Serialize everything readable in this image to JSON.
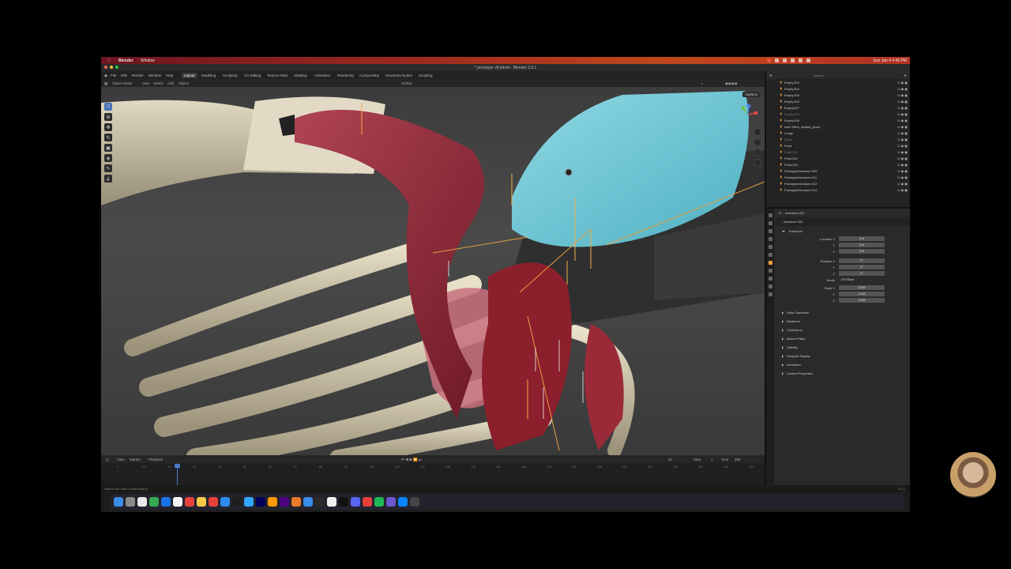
{
  "menubar": {
    "app": "Blender",
    "menu": "Window",
    "clock": "Sun Jan 4  4:46 PM"
  },
  "window": {
    "title": "* prototype v8.blend - Blender 5.0.1"
  },
  "blender_menu": {
    "items": [
      "File",
      "Edit",
      "Render",
      "Window",
      "Help"
    ],
    "workspaces": [
      "Layout",
      "Modeling",
      "Sculpting",
      "UV Editing",
      "Texture Paint",
      "Shading",
      "Animation",
      "Rendering",
      "Compositing",
      "Geometry Nodes",
      "Scripting"
    ],
    "active_workspace": "Layout",
    "scene": "Scene",
    "view_layer": "ViewLayer"
  },
  "viewport": {
    "mode": "Object Mode",
    "menus": [
      "View",
      "Select",
      "Add",
      "Object"
    ],
    "orientation": "Global",
    "perspective_label": "User Perspective",
    "options_label": "Options"
  },
  "timeline": {
    "menus": [
      "View",
      "Marker",
      "Playback"
    ],
    "current_frame": "22",
    "start_label": "Start",
    "start": "1",
    "end_label": "End",
    "end": "250",
    "ticks": [
      "0",
      "10",
      "20",
      "30",
      "40",
      "50",
      "60",
      "70",
      "80",
      "90",
      "100",
      "110",
      "120",
      "130",
      "140",
      "150",
      "160",
      "170",
      "180",
      "190",
      "200",
      "210",
      "220",
      "230",
      "240",
      "250"
    ]
  },
  "outliner": {
    "search_placeholder": "Search",
    "items": [
      {
        "name": "Empty.003",
        "dim": false
      },
      {
        "name": "Empty.004",
        "dim": false
      },
      {
        "name": "Empty.005",
        "dim": false
      },
      {
        "name": "Empty.006",
        "dim": false
      },
      {
        "name": "Empty.007",
        "dim": false
      },
      {
        "name": "Empty.008",
        "dim": true
      },
      {
        "name": "Empty.009",
        "dim": false
      },
      {
        "name": "low2.Sterb_default_group",
        "dim": false
      },
      {
        "name": "Lungs",
        "dim": false
      },
      {
        "name": "Glass",
        "dim": true
      },
      {
        "name": "Point",
        "dim": false
      },
      {
        "name": "Point.001",
        "dim": true
      },
      {
        "name": "Point.002",
        "dim": false
      },
      {
        "name": "Point.003",
        "dim": false
      },
      {
        "name": "PrototypeArmature.009",
        "dim": false
      },
      {
        "name": "PrototypeArmature.011",
        "dim": false
      },
      {
        "name": "PrototypeArmature.012",
        "dim": false
      },
      {
        "name": "PrototypeArmature.013",
        "dim": false
      }
    ]
  },
  "properties": {
    "object_name": "Armature.003",
    "data_name": "Armature.003",
    "transform_label": "Transform",
    "location_label": "Location X",
    "location": [
      "0 m",
      "0 m",
      "0 m"
    ],
    "rotation_label": "Rotation X",
    "rotation": [
      "0°",
      "0°",
      "0°"
    ],
    "mode_label": "Mode",
    "mode": "XYZ Euler",
    "scale_label": "Scale X",
    "scale": [
      "0.029",
      "0.029",
      "0.029"
    ],
    "sections": [
      "Delta Transform",
      "Relations",
      "Collections",
      "Motion Paths",
      "Visibility",
      "Viewport Display",
      "Animation",
      "Custom Properties"
    ]
  },
  "statusbar": {
    "left": "Select    Pan View    Context Menu",
    "right": "5.0.1"
  },
  "colors": {
    "menubar_start": "#6b1620",
    "menubar_end": "#c0481c",
    "accent": "#4a7bd0",
    "muscle": "#8c2230",
    "bone": "#d8ccb0",
    "cloth_blue": "#6cc5d4"
  }
}
